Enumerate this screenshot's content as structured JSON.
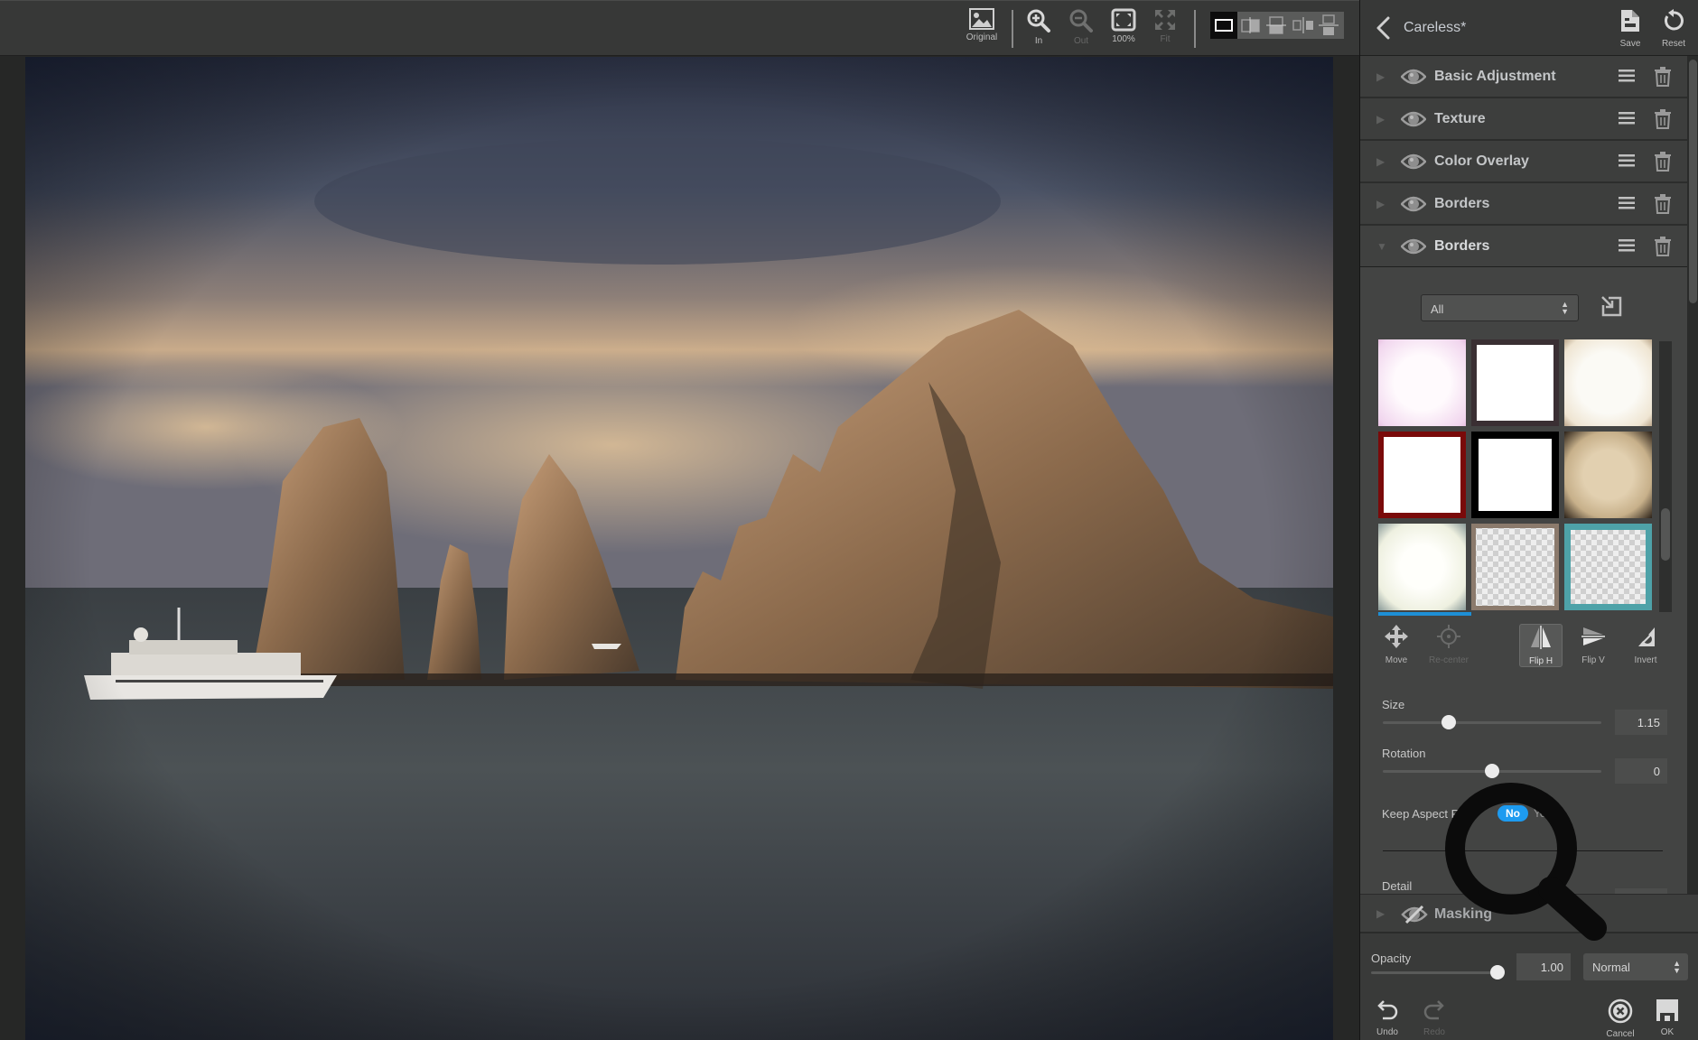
{
  "toolbar": {
    "original_label": "Original",
    "zoom_in_label": "In",
    "zoom_out_label": "Out",
    "zoom_100_label": "100%",
    "fit_label": "Fit",
    "view_modes": [
      "single-view",
      "split-vertical",
      "split-horizontal",
      "side-by-side",
      "stacked"
    ],
    "active_view_mode": "single-view"
  },
  "panel": {
    "header": {
      "title": "Careless*",
      "save_label": "Save",
      "reset_label": "Reset"
    },
    "layers": [
      {
        "name": "Basic Adjustment",
        "expanded": false,
        "visible": true
      },
      {
        "name": "Texture",
        "expanded": false,
        "visible": true
      },
      {
        "name": "Color Overlay",
        "expanded": false,
        "visible": true
      },
      {
        "name": "Borders",
        "expanded": false,
        "visible": true
      },
      {
        "name": "Borders",
        "expanded": true,
        "visible": true
      }
    ],
    "borders": {
      "category": "All",
      "thumbnails": [
        {
          "name": "pink-soft-border",
          "selected": false
        },
        {
          "name": "dark-thin-border",
          "selected": false
        },
        {
          "name": "grunge-cream-border",
          "selected": false
        },
        {
          "name": "red-frame-border",
          "selected": false
        },
        {
          "name": "black-rough-border",
          "selected": false
        },
        {
          "name": "sepia-vignette-border",
          "selected": false
        },
        {
          "name": "white-glow-border",
          "selected": true
        },
        {
          "name": "transparent-brown-border",
          "selected": false
        },
        {
          "name": "teal-grunge-border",
          "selected": false
        }
      ],
      "tools": {
        "move": "Move",
        "recenter": "Re-center",
        "flip_h": "Flip H",
        "flip_v": "Flip V",
        "invert": "Invert"
      },
      "active_tool": "Flip H",
      "size_label": "Size",
      "size_value": "1.15",
      "size_fraction": 0.3,
      "rotation_label": "Rotation",
      "rotation_value": "0",
      "rotation_fraction": 0.5,
      "keep_aspect_label": "Keep Aspect Ratio",
      "keep_aspect_no": "No",
      "keep_aspect_yes": "Yes",
      "keep_aspect_value": "No",
      "detail_label": "Detail"
    },
    "masking_label": "Masking",
    "footer": {
      "opacity_label": "Opacity",
      "opacity_value": "1.00",
      "opacity_fraction": 1.0,
      "blend_mode": "Normal",
      "undo_label": "Undo",
      "redo_label": "Redo",
      "cancel_label": "Cancel",
      "ok_label": "OK"
    }
  },
  "colors": {
    "accent": "#1d9bf0",
    "panel_bg": "#434443",
    "toolbar_bg": "#373837"
  }
}
